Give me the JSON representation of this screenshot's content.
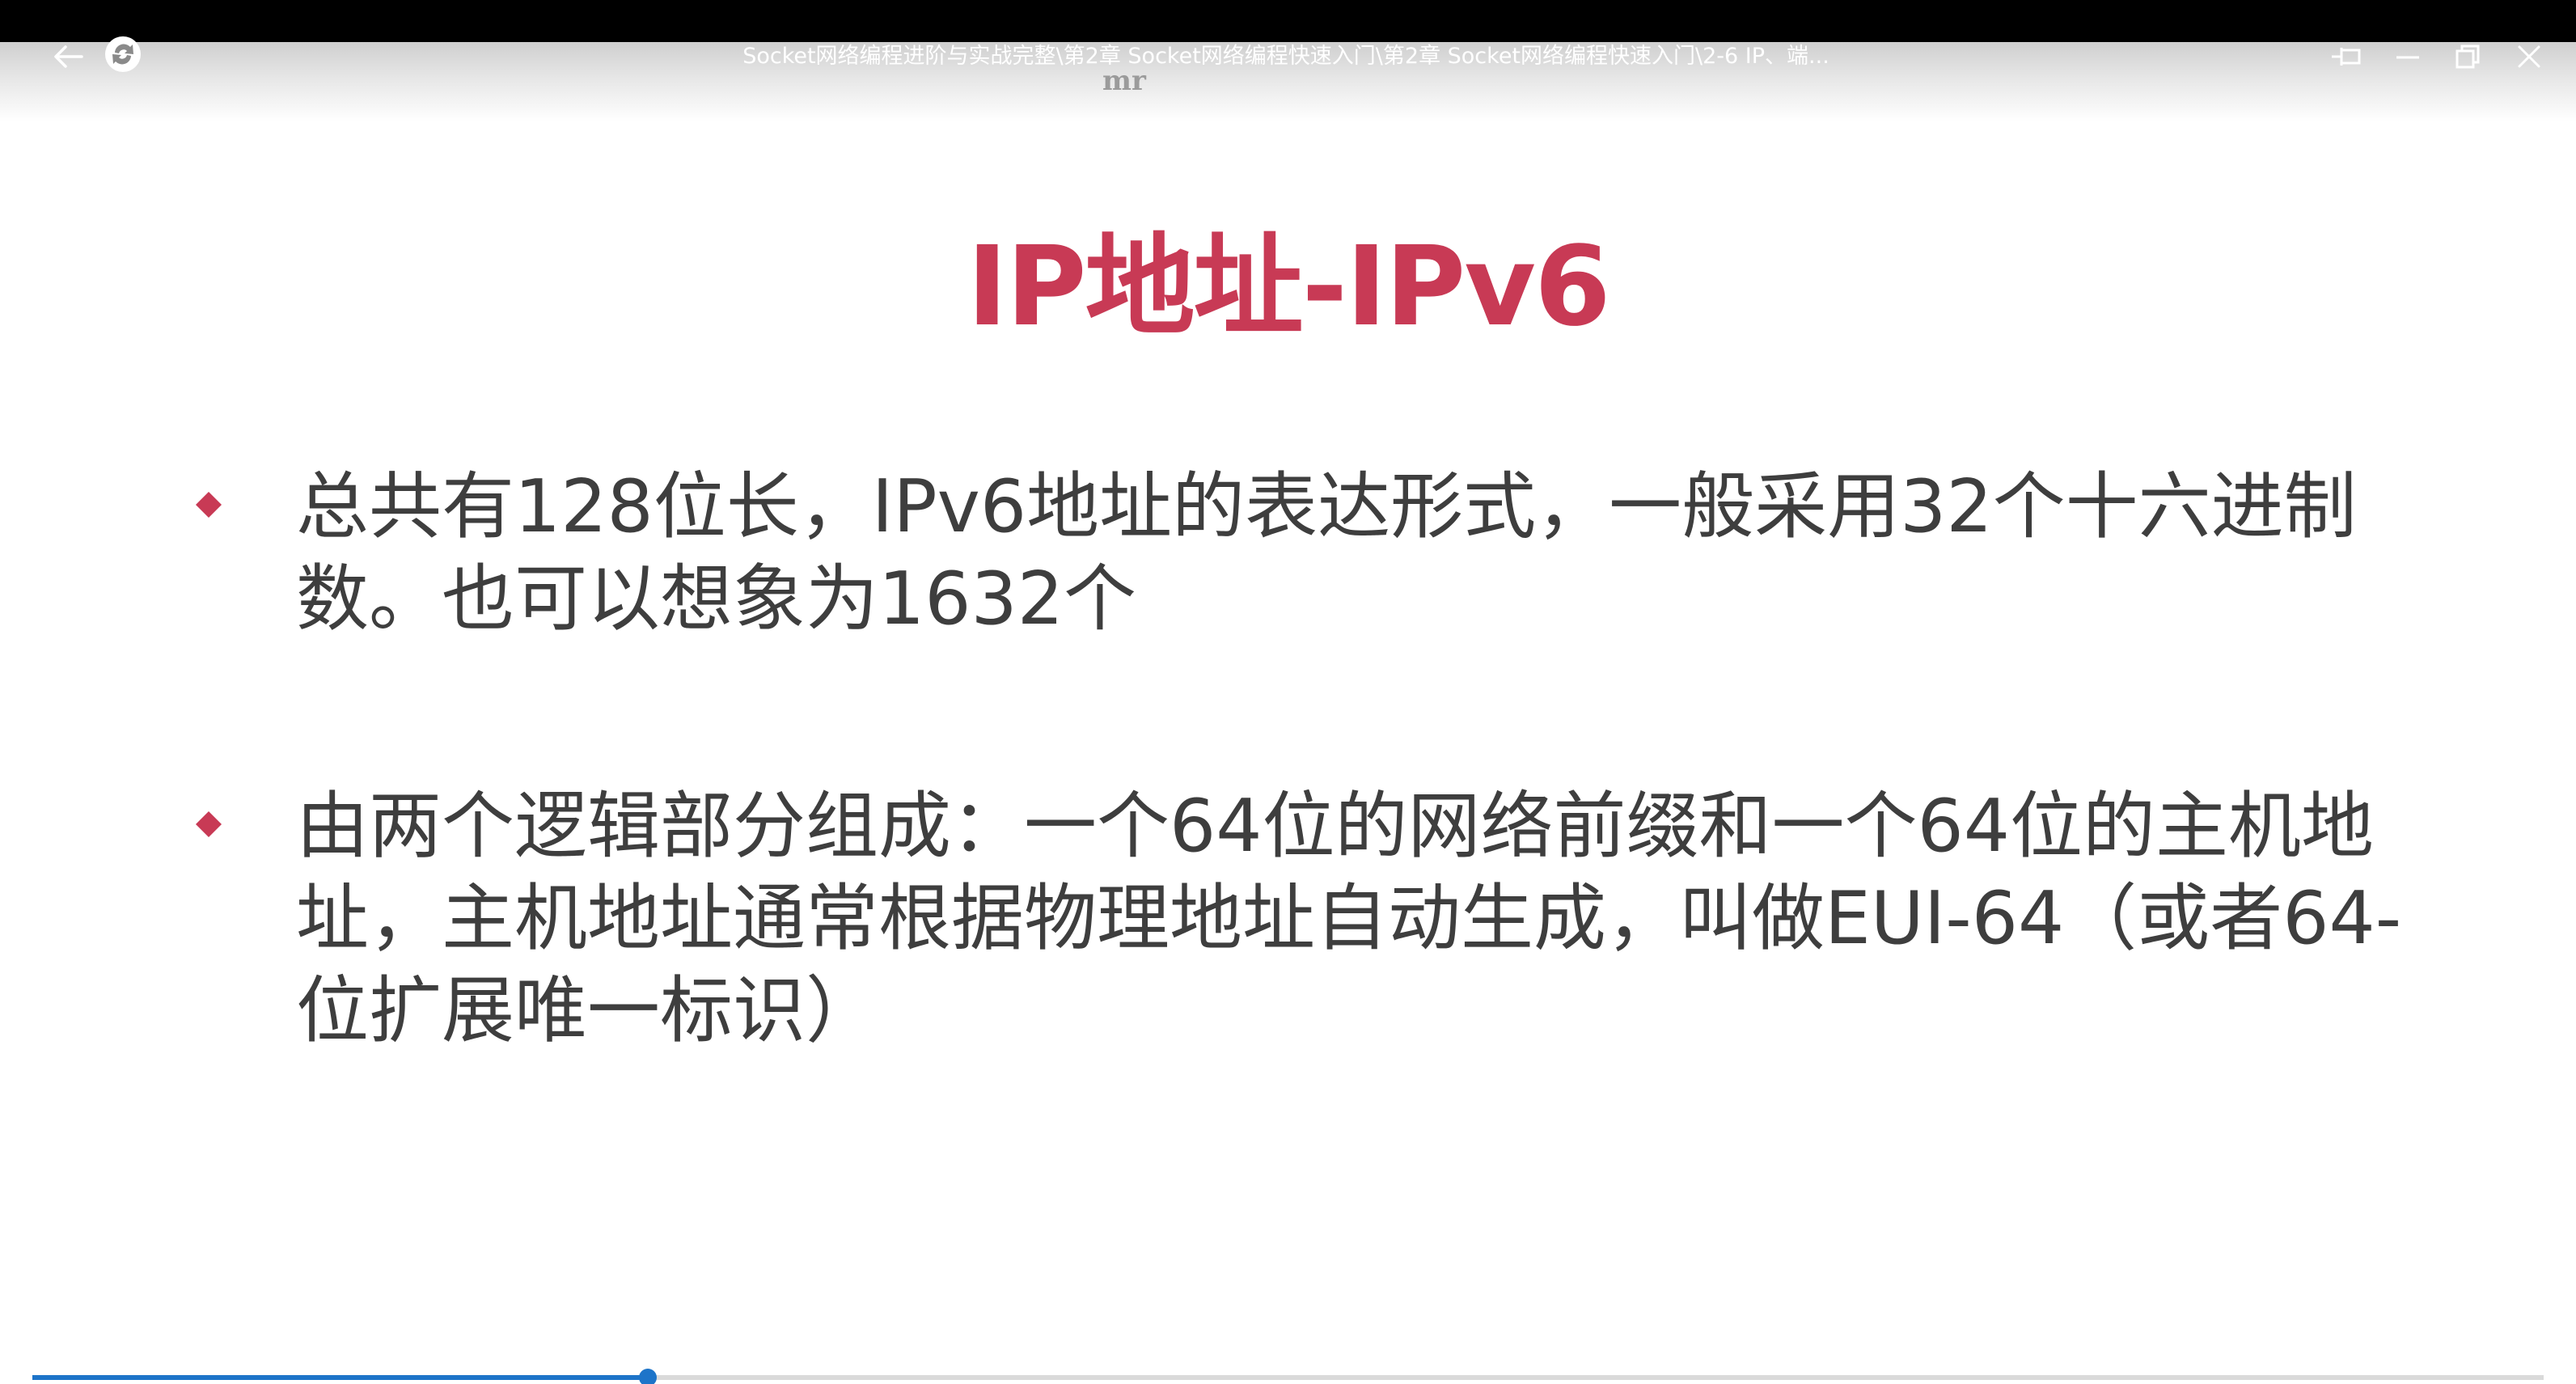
{
  "window": {
    "title": "Socket网络编程进阶与实战完整\\第2章 Socket网络编程快速入门\\第2章 Socket网络编程快速入门\\2-6 IP、端...",
    "watermark": "mr"
  },
  "slide": {
    "title": "IP地址-IPv6",
    "bullets": [
      {
        "text": "总共有128位长，IPv6地址的表达形式，一般采用32个十六进制数。也可以想象为1632个"
      },
      {
        "text": "由两个逻辑部分组成：一个64位的网络前缀和一个64位的主机地址，主机地址通常根据物理地址自动生成，叫做EUI-64（或者64-位扩展唯一标识）"
      }
    ]
  },
  "player": {
    "progress_fraction": 0.245
  },
  "colors": {
    "accent": "#c83a55",
    "body_text": "#3e3e3e",
    "progress": "#1d74c9"
  },
  "icons": {
    "back": "back-arrow-icon",
    "app": "app-logo-icon",
    "pin": "pin-icon",
    "minimize": "minimize-icon",
    "restore": "restore-icon",
    "close": "close-icon",
    "bullet": "diamond-bullet-icon"
  }
}
